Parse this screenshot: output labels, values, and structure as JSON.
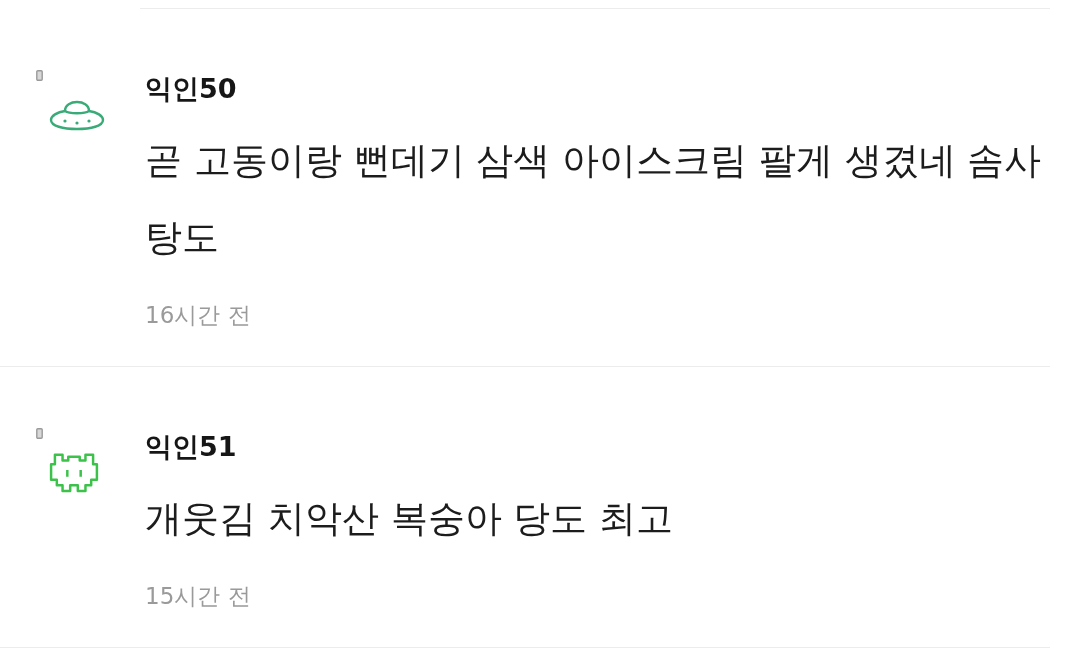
{
  "comments": [
    {
      "kind": "ufo",
      "author": "익인50",
      "body": "곧 고동이랑 뻔데기 삼색 아이스크림 팔게 생겼네 솜사탕도",
      "time": "16시간 전"
    },
    {
      "kind": "invader",
      "author": "익인51",
      "body": "개웃김 치악산 복숭아 당도 최고",
      "time": "15시간 전"
    }
  ]
}
